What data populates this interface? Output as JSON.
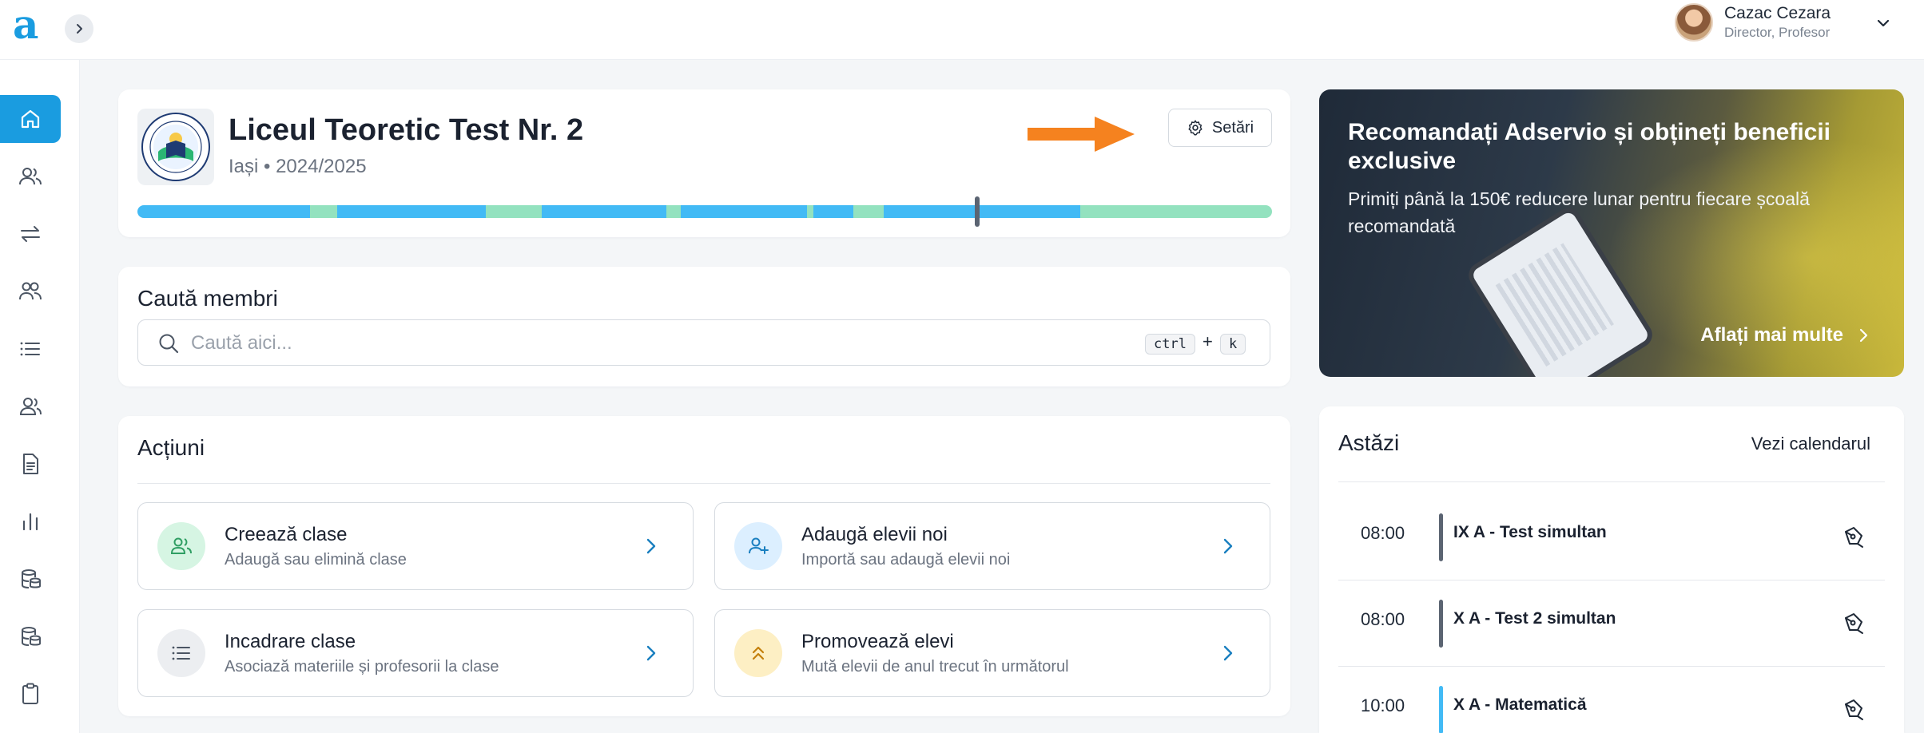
{
  "app": {
    "logo_letter": "a"
  },
  "user": {
    "name": "Cazac Cezara",
    "role": "Director, Profesor"
  },
  "sidebar": {
    "items": [
      {
        "name": "home",
        "active": true
      },
      {
        "name": "users"
      },
      {
        "name": "transfer"
      },
      {
        "name": "groups"
      },
      {
        "name": "list"
      },
      {
        "name": "members"
      },
      {
        "name": "documents"
      },
      {
        "name": "statistics"
      },
      {
        "name": "database"
      },
      {
        "name": "database-2"
      },
      {
        "name": "clipboard"
      }
    ]
  },
  "school": {
    "name": "Liceul Teoretic Test Nr. 2",
    "subtitle": "Iași • 2024/2025",
    "settings_label": "Setări",
    "progress_marker": 0.74
  },
  "search": {
    "title": "Caută membri",
    "placeholder": "Caută aici...",
    "shortcut_key1": "ctrl",
    "shortcut_plus": "+",
    "shortcut_key2": "k"
  },
  "actions": {
    "title": "Acțiuni",
    "items": [
      {
        "title": "Creează clase",
        "desc": "Adaugă sau elimină clase"
      },
      {
        "title": "Adaugă elevii noi",
        "desc": "Importă sau adaugă elevii noi"
      },
      {
        "title": "Incadrare clase",
        "desc": "Asociază materiile și profesorii la clase"
      },
      {
        "title": "Promovează elevi",
        "desc": "Mută elevii de anul trecut în următorul"
      }
    ]
  },
  "promo": {
    "title": "Recomandați Adservio și obțineți beneficii exclusive",
    "text": "Primiți până la 150€ reducere lunar pentru fiecare școală recomandată",
    "link": "Aflați mai multe"
  },
  "today": {
    "title": "Astăzi",
    "link": "Vezi calendarul",
    "events": [
      {
        "time": "08:00",
        "name": "IX A - Test simultan",
        "color": "#5b6472"
      },
      {
        "time": "08:00",
        "name": "X A - Test 2 simultan",
        "color": "#5b6472"
      },
      {
        "time": "10:00",
        "name": "X A - Matematică",
        "color": "#42baf5"
      }
    ]
  },
  "colors": {
    "accent": "#1a9ce0",
    "progress_blue": "#42baf5",
    "progress_green": "#93e2bf",
    "arrow": "#f5821f"
  }
}
